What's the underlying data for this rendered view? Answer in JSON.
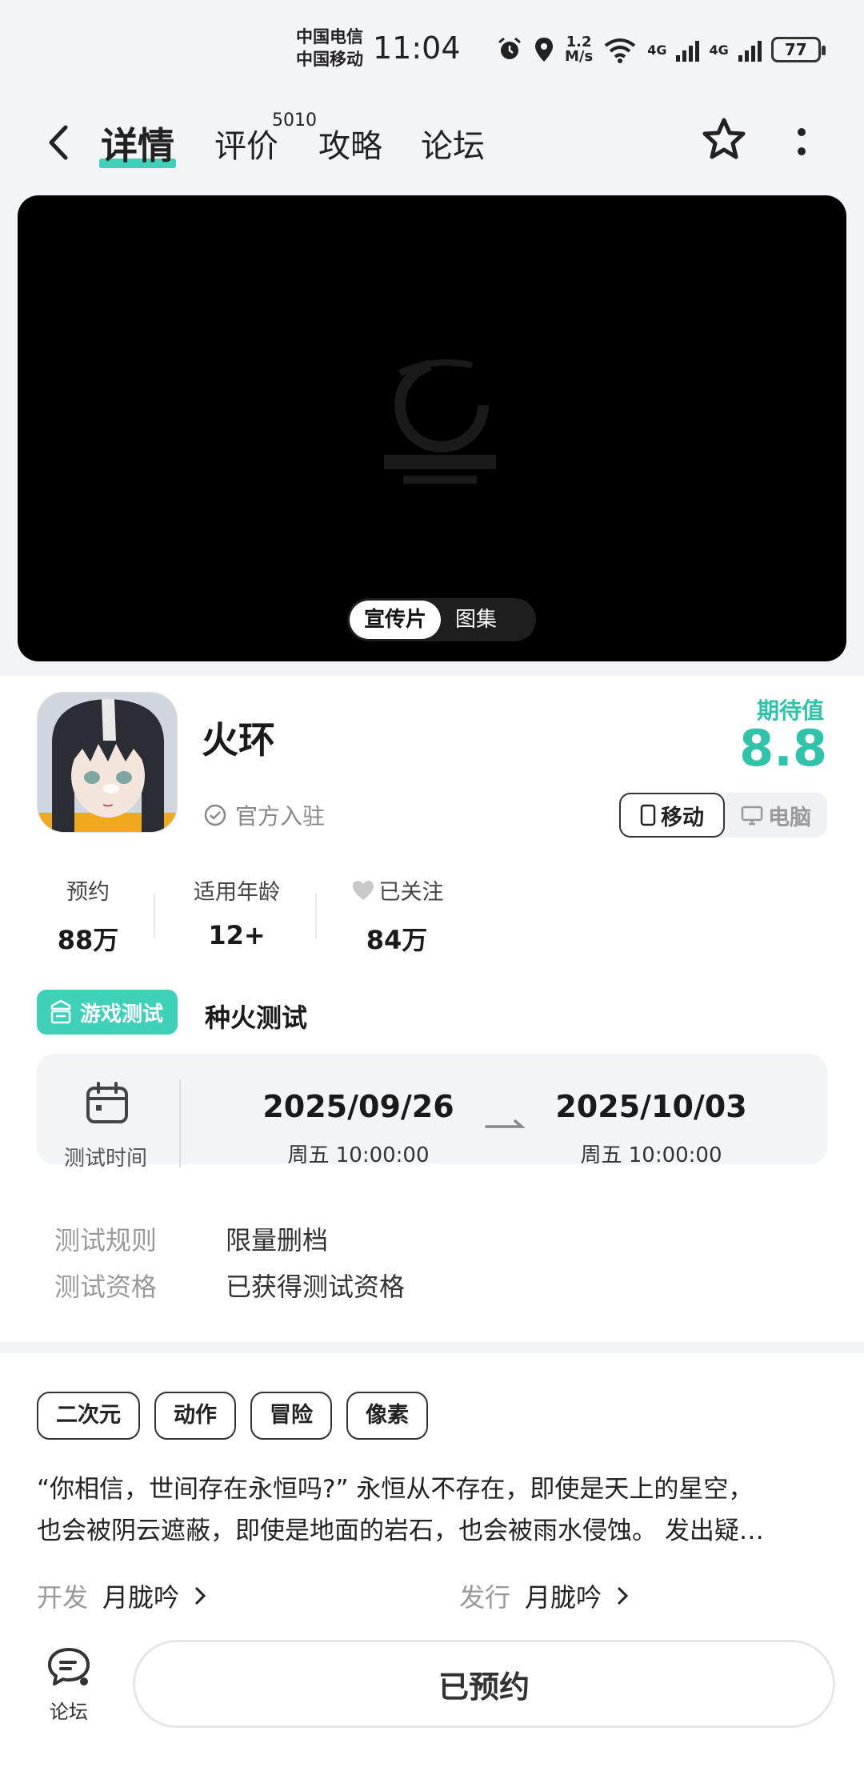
{
  "status_bar": {
    "carrier1": "中国电信",
    "carrier2": "中国移动",
    "time": "11:04",
    "speed_value": "1.2",
    "speed_unit": "M/s",
    "net1": "4G",
    "net2": "4G",
    "battery": "77"
  },
  "nav": {
    "tabs": [
      {
        "label": "详情"
      },
      {
        "label": "评价"
      },
      {
        "label": "攻略"
      },
      {
        "label": "论坛"
      }
    ],
    "review_count": "5010"
  },
  "media": {
    "switch": [
      "宣传片",
      "图集"
    ],
    "selected": "宣传片"
  },
  "game": {
    "title": "火环",
    "official": "官方入驻",
    "expect_label": "期待值",
    "expect_score": "8.8",
    "platforms": [
      {
        "label": "移动",
        "active": true
      },
      {
        "label": "电脑",
        "active": false
      }
    ]
  },
  "stats": [
    {
      "label": "预约",
      "value": "88万"
    },
    {
      "label": "适用年龄",
      "value": "12+"
    },
    {
      "label": "已关注",
      "value": "84万"
    }
  ],
  "test": {
    "tag": "游戏测试",
    "name": "种火测试",
    "time_label": "测试时间",
    "start_date": "2025/09/26",
    "start_time": "周五  10:00:00",
    "end_date": "2025/10/03",
    "end_time": "周五  10:00:00",
    "rules": [
      {
        "key": "测试规则",
        "value": "限量删档"
      },
      {
        "key": "测试资格",
        "value": "已获得测试资格"
      }
    ]
  },
  "tags": [
    "二次元",
    "动作",
    "冒险",
    "像素"
  ],
  "description": {
    "line1": "“你相信，世间存在永恒吗?” 永恒从不存在，即使是天上的星空，",
    "line2": "也会被阴云遮蔽，即使是地面的岩石，也会被雨水侵蚀。 发出疑…"
  },
  "developer": {
    "key": "开发",
    "value": "月胧吟"
  },
  "publisher": {
    "key": "发行",
    "value": "月胧吟"
  },
  "bottom": {
    "forum_label": "论坛",
    "reserve_label": "已预约"
  },
  "colors": {
    "accent": "#3fd0b8",
    "score": "#2fc3aa",
    "page_bg": "#f3f4f7"
  }
}
